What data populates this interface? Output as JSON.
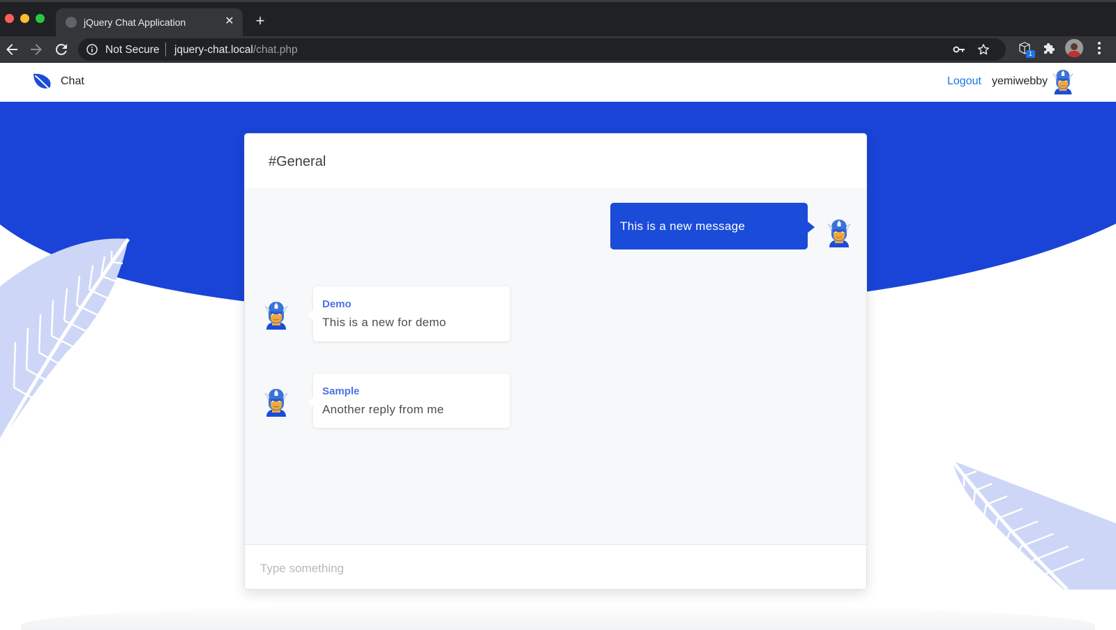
{
  "browser": {
    "tab_title": "jQuery Chat Application",
    "security_label": "Not Secure",
    "url_host": "jquery-chat.local",
    "url_path": "/chat.php",
    "extension_badge": "1"
  },
  "navbar": {
    "brand": "Chat",
    "logout": "Logout",
    "username": "yemiwebby"
  },
  "chat": {
    "channel": "#General",
    "messages": [
      {
        "direction": "outgoing",
        "text": "This is a new message"
      },
      {
        "direction": "incoming",
        "sender": "Demo",
        "text": "This is a new for demo"
      },
      {
        "direction": "incoming",
        "sender": "Sample",
        "text": "Another reply from me"
      }
    ],
    "input_placeholder": "Type something"
  },
  "colors": {
    "brand_blue": "#1a4bd9",
    "link_blue": "#1a73e8",
    "sender_blue": "#4a73e8",
    "leaf_tint": "#cdd6f6"
  },
  "icons": [
    "back-arrow-icon",
    "forward-arrow-icon",
    "reload-icon",
    "info-icon",
    "key-icon",
    "star-icon",
    "extension-icon",
    "puzzle-icon",
    "menu-icon",
    "leaf-logo-icon",
    "captain-avatar-icon"
  ]
}
